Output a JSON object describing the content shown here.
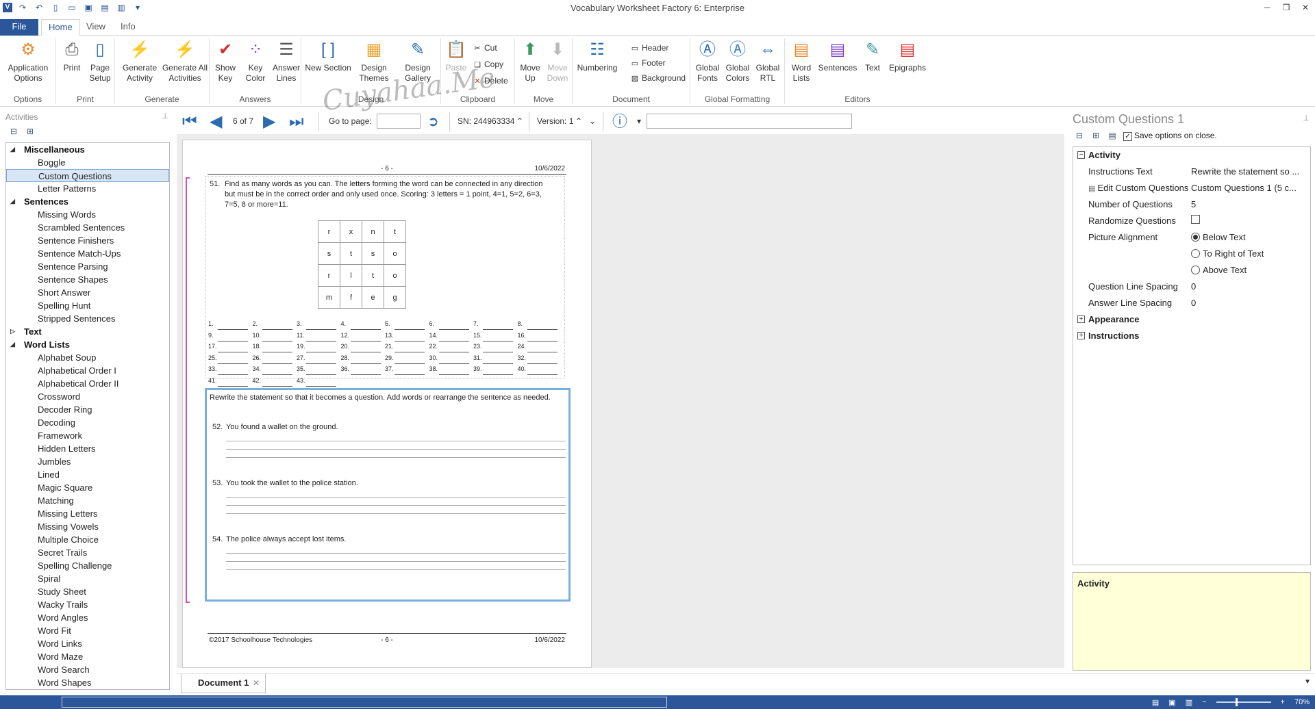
{
  "window": {
    "title": "Vocabulary Worksheet Factory 6: Enterprise",
    "app_logo": "V"
  },
  "tabs": [
    "File",
    "Home",
    "View",
    "Info"
  ],
  "ribbon": {
    "groups": {
      "options": "Options",
      "print": "Print",
      "generate": "Generate",
      "answers": "Answers",
      "design": "Design",
      "clipboard": "Clipboard",
      "move": "Move",
      "document": "Document",
      "global_formatting": "Global Formatting",
      "editors": "Editors"
    },
    "buttons": {
      "app_options": "Application Options",
      "print": "Print",
      "page_setup": "Page Setup",
      "generate_activity": "Generate Activity",
      "generate_all": "Generate All Activities",
      "show_key": "Show Key",
      "key_color": "Key Color",
      "answer_lines": "Answer Lines",
      "new_section": "New Section",
      "design_themes": "Design Themes",
      "design_gallery": "Design Gallery",
      "paste": "Paste",
      "cut": "Cut",
      "copy": "Copy",
      "delete": "Delete",
      "move_up": "Move Up",
      "move_down": "Move Down",
      "numbering": "Numbering",
      "header": "Header",
      "footer": "Footer",
      "background": "Background",
      "global_fonts": "Global Fonts",
      "global_colors": "Global Colors",
      "global_rtl": "Global RTL",
      "word_lists": "Word Lists",
      "sentences": "Sentences",
      "text": "Text",
      "epigraphs": "Epigraphs"
    },
    "watermark": "Cuyahaa.Me"
  },
  "activities_panel": {
    "title": "Activities",
    "tree": [
      {
        "type": "cat",
        "label": "Miscellaneous",
        "open": true
      },
      {
        "type": "leaf",
        "label": "Boggle"
      },
      {
        "type": "leaf",
        "label": "Custom Questions",
        "selected": true
      },
      {
        "type": "leaf",
        "label": "Letter Patterns"
      },
      {
        "type": "cat",
        "label": "Sentences",
        "open": true
      },
      {
        "type": "leaf",
        "label": "Missing Words"
      },
      {
        "type": "leaf",
        "label": "Scrambled Sentences"
      },
      {
        "type": "leaf",
        "label": "Sentence Finishers"
      },
      {
        "type": "leaf",
        "label": "Sentence Match-Ups"
      },
      {
        "type": "leaf",
        "label": "Sentence Parsing"
      },
      {
        "type": "leaf",
        "label": "Sentence Shapes"
      },
      {
        "type": "leaf",
        "label": "Short Answer"
      },
      {
        "type": "leaf",
        "label": "Spelling Hunt"
      },
      {
        "type": "leaf",
        "label": "Stripped Sentences"
      },
      {
        "type": "cat",
        "label": "Text",
        "open": false
      },
      {
        "type": "cat",
        "label": "Word Lists",
        "open": true
      },
      {
        "type": "leaf",
        "label": "Alphabet Soup"
      },
      {
        "type": "leaf",
        "label": "Alphabetical Order I"
      },
      {
        "type": "leaf",
        "label": "Alphabetical Order II"
      },
      {
        "type": "leaf",
        "label": "Crossword"
      },
      {
        "type": "leaf",
        "label": "Decoder Ring"
      },
      {
        "type": "leaf",
        "label": "Decoding"
      },
      {
        "type": "leaf",
        "label": "Framework"
      },
      {
        "type": "leaf",
        "label": "Hidden Letters"
      },
      {
        "type": "leaf",
        "label": "Jumbles"
      },
      {
        "type": "leaf",
        "label": "Lined"
      },
      {
        "type": "leaf",
        "label": "Magic Square"
      },
      {
        "type": "leaf",
        "label": "Matching"
      },
      {
        "type": "leaf",
        "label": "Missing Letters"
      },
      {
        "type": "leaf",
        "label": "Missing Vowels"
      },
      {
        "type": "leaf",
        "label": "Multiple Choice"
      },
      {
        "type": "leaf",
        "label": "Secret Trails"
      },
      {
        "type": "leaf",
        "label": "Spelling Challenge"
      },
      {
        "type": "leaf",
        "label": "Spiral"
      },
      {
        "type": "leaf",
        "label": "Study Sheet"
      },
      {
        "type": "leaf",
        "label": "Wacky Trails"
      },
      {
        "type": "leaf",
        "label": "Word Angles"
      },
      {
        "type": "leaf",
        "label": "Word Fit"
      },
      {
        "type": "leaf",
        "label": "Word Links"
      },
      {
        "type": "leaf",
        "label": "Word Maze"
      },
      {
        "type": "leaf",
        "label": "Word Search"
      },
      {
        "type": "leaf",
        "label": "Word Shapes"
      }
    ]
  },
  "doc_toolbar": {
    "page_indicator": "6 of 7",
    "goto_label": "Go to page:",
    "goto_value": "",
    "sn": "SN: 244963334",
    "version": "Version: 1"
  },
  "page": {
    "header_num": "- 6 -",
    "header_date": "10/6/2022",
    "footer_copy": "©2017 Schoolhouse Technologies",
    "footer_num": "- 6 -",
    "footer_date": "10/6/2022",
    "q51": {
      "num": "51.",
      "text": "Find as many words as you can. The letters forming the word can be connected in any direction but must be in the correct order and only used once. Scoring: 3 letters = 1 point, 4=1, 5=2, 6=3, 7=5, 8 or more=11."
    },
    "grid": [
      [
        "r",
        "x",
        "n",
        "t"
      ],
      [
        "s",
        "t",
        "s",
        "o"
      ],
      [
        "r",
        "l",
        "t",
        "o"
      ],
      [
        "m",
        "f",
        "e",
        "g"
      ]
    ],
    "blank_count": 43,
    "instructions": "Rewrite the statement so that it becomes a question. Add words or rearrange the sentence as needed.",
    "questions": [
      {
        "num": "52.",
        "text": "You found a wallet on the ground."
      },
      {
        "num": "53.",
        "text": "You took the wallet to the police station."
      },
      {
        "num": "54.",
        "text": "The police always accept lost items."
      }
    ]
  },
  "props_panel": {
    "title": "Custom Questions 1",
    "save_options": "Save options on close.",
    "activity_cat": "Activity",
    "rows": {
      "instructions_text_key": "Instructions Text",
      "instructions_text_val": "Rewrite the statement so ...",
      "edit_cq_key": "Edit Custom Questions",
      "edit_cq_val": "Custom Questions 1 (5 c...",
      "num_q_key": "Number of Questions",
      "num_q_val": "5",
      "randomize_key": "Randomize Questions",
      "pic_align_key": "Picture Alignment",
      "align_below": "Below Text",
      "align_right": "To Right of Text",
      "align_above": "Above Text",
      "q_spacing_key": "Question Line Spacing",
      "q_spacing_val": "0",
      "a_spacing_key": "Answer Line Spacing",
      "a_spacing_val": "0"
    },
    "appearance_cat": "Appearance",
    "instructions_cat": "Instructions",
    "help_title": "Activity"
  },
  "doc_tab": "Document 1",
  "status": {
    "zoom": "70%"
  }
}
